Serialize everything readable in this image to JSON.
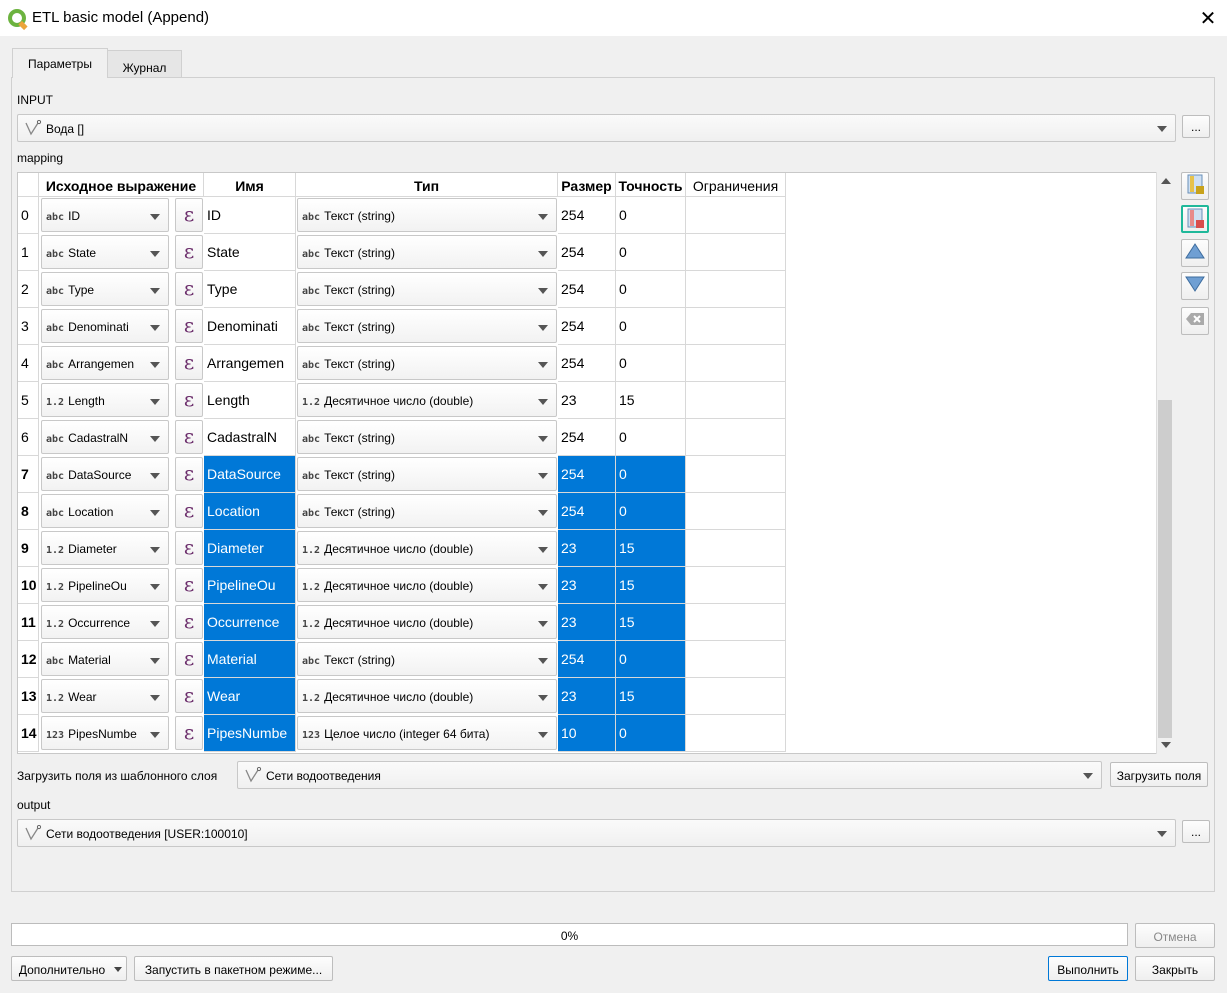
{
  "window": {
    "title": "ETL basic model (Append)",
    "close_icon": "close-icon"
  },
  "tabs": [
    {
      "label": "Параметры",
      "active": true
    },
    {
      "label": "Журнал",
      "active": false
    }
  ],
  "input": {
    "label": "INPUT",
    "value": "Вода []",
    "more": "..."
  },
  "mapping": {
    "label": "mapping",
    "headers": [
      "Исходное выражение",
      "Имя",
      "Тип",
      "Размер",
      "Точность",
      "Ограничения"
    ],
    "rows": [
      {
        "n": "0",
        "src_type": "abc",
        "src": "ID",
        "name": "ID",
        "type_tag": "abc",
        "type": "Текст (string)",
        "size": "254",
        "prec": "0",
        "selected": false
      },
      {
        "n": "1",
        "src_type": "abc",
        "src": "State",
        "name": "State",
        "type_tag": "abc",
        "type": "Текст (string)",
        "size": "254",
        "prec": "0",
        "selected": false
      },
      {
        "n": "2",
        "src_type": "abc",
        "src": "Type",
        "name": "Type",
        "type_tag": "abc",
        "type": "Текст (string)",
        "size": "254",
        "prec": "0",
        "selected": false
      },
      {
        "n": "3",
        "src_type": "abc",
        "src": "Denominati",
        "name": "Denominati",
        "type_tag": "abc",
        "type": "Текст (string)",
        "size": "254",
        "prec": "0",
        "selected": false
      },
      {
        "n": "4",
        "src_type": "abc",
        "src": "Arrangemen",
        "name": "Arrangemen",
        "type_tag": "abc",
        "type": "Текст (string)",
        "size": "254",
        "prec": "0",
        "selected": false
      },
      {
        "n": "5",
        "src_type": "1.2",
        "src": "Length",
        "name": "Length",
        "type_tag": "1.2",
        "type": "Десятичное число (double)",
        "size": "23",
        "prec": "15",
        "selected": false
      },
      {
        "n": "6",
        "src_type": "abc",
        "src": "CadastralN",
        "name": "CadastralN",
        "type_tag": "abc",
        "type": "Текст (string)",
        "size": "254",
        "prec": "0",
        "selected": false
      },
      {
        "n": "7",
        "src_type": "abc",
        "src": "DataSource",
        "name": "DataSource",
        "type_tag": "abc",
        "type": "Текст (string)",
        "size": "254",
        "prec": "0",
        "selected": true
      },
      {
        "n": "8",
        "src_type": "abc",
        "src": "Location",
        "name": "Location",
        "type_tag": "abc",
        "type": "Текст (string)",
        "size": "254",
        "prec": "0",
        "selected": true
      },
      {
        "n": "9",
        "src_type": "1.2",
        "src": "Diameter",
        "name": "Diameter",
        "type_tag": "1.2",
        "type": "Десятичное число (double)",
        "size": "23",
        "prec": "15",
        "selected": true
      },
      {
        "n": "10",
        "src_type": "1.2",
        "src": "PipelineOu",
        "name": "PipelineOu",
        "type_tag": "1.2",
        "type": "Десятичное число (double)",
        "size": "23",
        "prec": "15",
        "selected": true
      },
      {
        "n": "11",
        "src_type": "1.2",
        "src": "Occurrence",
        "name": "Occurrence",
        "type_tag": "1.2",
        "type": "Десятичное число (double)",
        "size": "23",
        "prec": "15",
        "selected": true
      },
      {
        "n": "12",
        "src_type": "abc",
        "src": "Material",
        "name": "Material",
        "type_tag": "abc",
        "type": "Текст (string)",
        "size": "254",
        "prec": "0",
        "selected": true
      },
      {
        "n": "13",
        "src_type": "1.2",
        "src": "Wear",
        "name": "Wear",
        "type_tag": "1.2",
        "type": "Десятичное число (double)",
        "size": "23",
        "prec": "15",
        "selected": true
      },
      {
        "n": "14",
        "src_type": "123",
        "src": "PipesNumbe",
        "name": "PipesNumbe",
        "type_tag": "123",
        "type": "Целое число (integer 64 бита)",
        "size": "10",
        "prec": "0",
        "selected": true
      }
    ]
  },
  "template": {
    "label": "Загрузить поля из шаблонного слоя",
    "value": "Сети водоотведения",
    "button": "Загрузить поля"
  },
  "output": {
    "label": "output",
    "value": "Сети водоотведения [USER:100010]",
    "more": "..."
  },
  "progress": {
    "text": "0%",
    "value": 0
  },
  "buttons": {
    "cancel": "Отмена",
    "advanced": "Дополнительно",
    "batch": "Запустить в пакетном режиме...",
    "run": "Выполнить",
    "close": "Закрыть"
  },
  "colors": {
    "selection": "#0078d7",
    "epsilon": "#6b2d6b"
  }
}
